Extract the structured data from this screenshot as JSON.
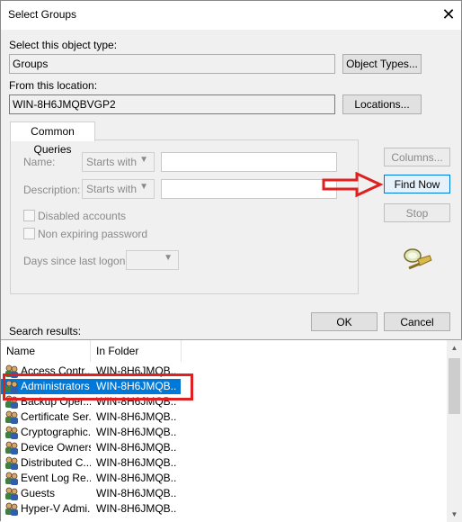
{
  "window": {
    "title": "Select Groups",
    "close_glyph": "✕"
  },
  "object_type": {
    "label": "Select this object type:",
    "value": "Groups",
    "button": "Object Types..."
  },
  "location": {
    "label": "From this location:",
    "value": "WIN-8H6JMQBVGP2",
    "button": "Locations..."
  },
  "queries": {
    "tab": "Common Queries",
    "name_label": "Name:",
    "name_mode": "Starts with",
    "description_label": "Description:",
    "description_mode": "Starts with",
    "disabled_label": "Disabled accounts",
    "nonexpiring_label": "Non expiring password",
    "days_label": "Days since last logon:",
    "columns_button": "Columns...",
    "find_now_button": "Find Now",
    "stop_button": "Stop",
    "search_icon": "magnifier-search-icon"
  },
  "actions": {
    "ok": "OK",
    "cancel": "Cancel"
  },
  "results": {
    "label": "Search results:",
    "columns": [
      "Name",
      "In Folder"
    ],
    "rows": [
      {
        "name": "Access Contr...",
        "folder": "WIN-8H6JMQB..."
      },
      {
        "name": "Administrators",
        "folder": "WIN-8H6JMQB...",
        "selected": true
      },
      {
        "name": "Backup Oper...",
        "folder": "WIN-8H6JMQB..."
      },
      {
        "name": "Certificate Ser...",
        "folder": "WIN-8H6JMQB..."
      },
      {
        "name": "Cryptographic...",
        "folder": "WIN-8H6JMQB..."
      },
      {
        "name": "Device Owners",
        "folder": "WIN-8H6JMQB..."
      },
      {
        "name": "Distributed C...",
        "folder": "WIN-8H6JMQB..."
      },
      {
        "name": "Event Log Re...",
        "folder": "WIN-8H6JMQB..."
      },
      {
        "name": "Guests",
        "folder": "WIN-8H6JMQB..."
      },
      {
        "name": "Hyper-V Admi...",
        "folder": "WIN-8H6JMQB..."
      }
    ]
  },
  "annotations": {
    "arrow_color": "#e02020",
    "highlight_color": "#e02020"
  }
}
